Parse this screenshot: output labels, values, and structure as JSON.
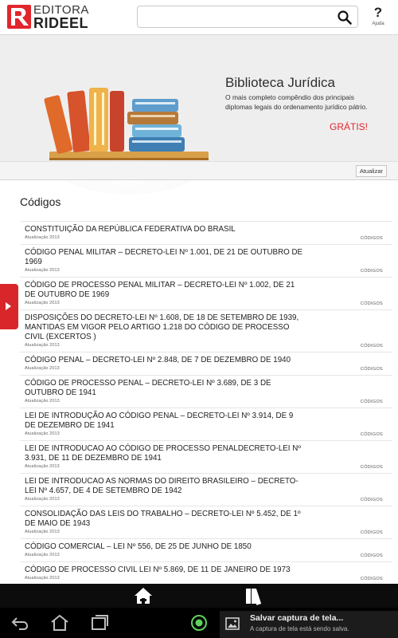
{
  "brand": {
    "line1": "EDITORA",
    "line2": "RIDEEL"
  },
  "search": {
    "value": "",
    "placeholder": ""
  },
  "help": {
    "symbol": "?",
    "label": "Ajuda"
  },
  "banner": {
    "title": "Biblioteca Jurídica",
    "description": "O mais completo compêndio dos principais diplomas legais do ordenamento jurídico pátrio.",
    "free_label": "GRÁTIS!",
    "update_label": "Atualizar"
  },
  "section": {
    "title": "Códigos"
  },
  "items": [
    {
      "title": "CONSTITUIÇÃO DA REPÚBLICA FEDERATIVA DO BRASIL",
      "subtitle": "Atualização 2013",
      "tag": "CÓDIGOS"
    },
    {
      "title": "CÓDIGO PENAL MILITAR – DECRETO-LEI  Nº 1.001, DE 21 DE OUTUBRO DE 1969",
      "subtitle": "Atualização 2013",
      "tag": "CÓDIGOS"
    },
    {
      "title": "CÓDIGO DE PROCESSO PENAL MILITAR – DECRETO-LEI  Nº 1.002, DE 21 DE OUTUBRO DE 1969",
      "subtitle": "Atualização 2013",
      "tag": "CÓDIGOS"
    },
    {
      "title": "DISPOSIÇÕES DO DECRETO-LEI  Nº 1.608, DE 18 DE SETEMBRO DE 1939, MANTIDAS EM VIGOR PELO ARTIGO 1.218 DO CÓDIGO DE PROCESSO CIVIL (EXCERTOS )",
      "subtitle": "Atualização 2013",
      "tag": "CÓDIGOS"
    },
    {
      "title": "CÓDIGO PENAL – DECRETO-LEI  Nº 2.848, DE 7 DE DEZEMBRO DE 1940",
      "subtitle": "Atualização 2013",
      "tag": "CÓDIGOS"
    },
    {
      "title": "CÓDIGO DE PROCESSO PENAL – DECRETO-LEI  Nº 3.689, DE 3 DE OUTUBRO DE 1941",
      "subtitle": "Atualização 2013",
      "tag": "CÓDIGOS"
    },
    {
      "title": "LEI  DE INTRODUÇÃO AO CÓDIGO PENAL – DECRETO-LEI  Nº 3.914, DE 9 DE DEZEMBRO DE 1941",
      "subtitle": "Atualização 2013",
      "tag": "CÓDIGOS"
    },
    {
      "title": "LEI  DE INTRODUCAO AO CÓDIGO DE PROCESSO PENALDECRETO-LEI  Nº 3.931, DE 11 DE DEZEMBRO DE 1941",
      "subtitle": "Atualização 2013",
      "tag": "CÓDIGOS"
    },
    {
      "title": "LEI  DE INTRODUCAO AS NORMAS DO DIREITO BRASILEIRO – DECRETO-LEI  Nº 4.657, DE 4 DE SETEMBRO DE 1942",
      "subtitle": "Atualização 2013",
      "tag": "CÓDIGOS"
    },
    {
      "title": "CONSOLIDAÇÃO DAS LEIS DO TRABALHO – DECRETO-LEI  Nº 5.452, DE 1º DE MAIO DE 1943",
      "subtitle": "Atualização 2013",
      "tag": "CÓDIGOS"
    },
    {
      "title": "CÓDIGO COMERCIAL – LEI  Nº 556, DE 25 DE JUNHO DE 1850",
      "subtitle": "Atualização 2013",
      "tag": "CÓDIGOS"
    },
    {
      "title": "CÓDIGO DE PROCESSO CIVIL LEI Nº 5.869, DE 11 DE JANEIRO DE 1973",
      "subtitle": "Atualização 2013",
      "tag": "CÓDIGOS"
    }
  ],
  "appbar": {
    "home_icon": "home-icon",
    "library_icon": "books-icon"
  },
  "notification": {
    "title": "Salvar captura de tela...",
    "text": "A captura de tela está sendo salva."
  },
  "colors": {
    "brand_red": "#e1262c",
    "banner_bg": "#efeeee"
  }
}
